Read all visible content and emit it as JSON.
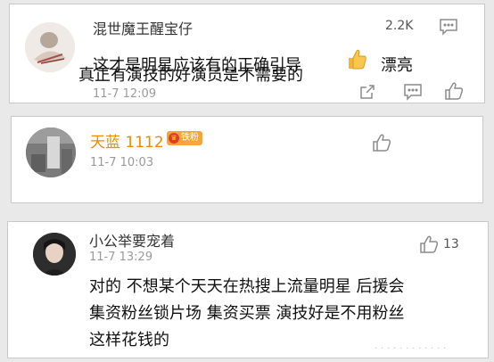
{
  "colors": {
    "page_bg": "#e9e9e9",
    "card_bg": "#ffffff",
    "name_vip": "#f08a00",
    "timestamp": "#9a9a9a",
    "badge_bg": "#f3a73b"
  },
  "comments": [
    {
      "username": "混世魔王醒宝仔",
      "text": "这才是明星应该有的正确引导",
      "emoji": "thumbs-up-emoji",
      "text_suffix": "漂亮",
      "time": "11-7 12:09",
      "actions": [
        "share-icon",
        "comment-icon",
        "like-icon"
      ]
    },
    {
      "username": "天蓝 1112",
      "badge": "铁粉",
      "time": "11-7 10:03",
      "likes": "2.2K",
      "text": "真正有演技的好演员是不需要的",
      "actions": [
        "like-icon",
        "comment-icon"
      ]
    },
    {
      "username": "小公举要宠着",
      "time": "11-7 13:29",
      "likes": "13",
      "text_lines": [
        "对的 不想某个天天在热搜上流量明星 后援会",
        "集资粉丝锁片场 集资买票 演技好是不用粉丝",
        "这样花钱的"
      ],
      "actions": [
        "like-icon"
      ]
    }
  ]
}
